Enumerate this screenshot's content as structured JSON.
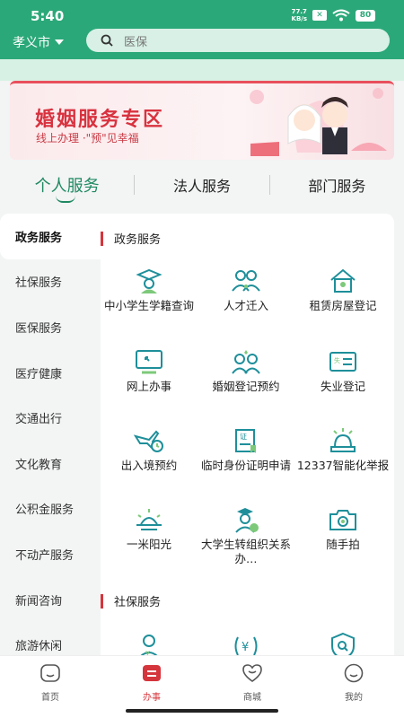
{
  "status": {
    "time": "5:40",
    "net_speed": "77.7",
    "net_unit": "KB/s",
    "battery": "80"
  },
  "header": {
    "city": "孝义市",
    "search_placeholder": "医保"
  },
  "banner": {
    "title": "婚姻服务专区",
    "subtitle": "线上办理 ·\"预\"见幸福"
  },
  "tabs": [
    {
      "label": "个人服务",
      "active": true
    },
    {
      "label": "法人服务",
      "active": false
    },
    {
      "label": "部门服务",
      "active": false
    }
  ],
  "sidebar": [
    {
      "label": "政务服务",
      "active": true
    },
    {
      "label": "社保服务"
    },
    {
      "label": "医保服务"
    },
    {
      "label": "医疗健康"
    },
    {
      "label": "交通出行"
    },
    {
      "label": "文化教育"
    },
    {
      "label": "公积金服务"
    },
    {
      "label": "不动产服务"
    },
    {
      "label": "新闻咨询"
    },
    {
      "label": "旅游休闲"
    }
  ],
  "sections": [
    {
      "title": "政务服务",
      "items": [
        {
          "label": "中小学生学籍查询",
          "icon": "student-cap-icon"
        },
        {
          "label": "人才迁入",
          "icon": "talent-icon"
        },
        {
          "label": "租赁房屋登记",
          "icon": "house-icon"
        },
        {
          "label": "网上办事",
          "icon": "monitor-icon"
        },
        {
          "label": "婚姻登记预约",
          "icon": "couple-icon"
        },
        {
          "label": "失业登记",
          "icon": "id-card-icon"
        },
        {
          "label": "出入境预约",
          "icon": "plane-clock-icon"
        },
        {
          "label": "临时身份证明申请",
          "icon": "certificate-icon"
        },
        {
          "label": "12337智能化举报",
          "icon": "alarm-bell-icon"
        },
        {
          "label": "一米阳光",
          "icon": "sun-icon"
        },
        {
          "label": "大学生转组织关系办…",
          "icon": "graduate-icon"
        },
        {
          "label": "随手拍",
          "icon": "camera-icon"
        }
      ]
    },
    {
      "title": "社保服务",
      "items": [
        {
          "label": "",
          "icon": "person-badge-icon"
        },
        {
          "label": "",
          "icon": "yuan-icon"
        },
        {
          "label": "",
          "icon": "shield-search-icon"
        }
      ]
    }
  ],
  "bottom_nav": [
    {
      "label": "首页",
      "icon": "home-icon"
    },
    {
      "label": "办事",
      "icon": "service-icon",
      "active": true
    },
    {
      "label": "商城",
      "icon": "mall-icon"
    },
    {
      "label": "我的",
      "icon": "profile-icon"
    }
  ],
  "colors": {
    "brand_green": "#2ba879",
    "accent_red": "#d5353c",
    "icon_teal": "#1e8f9a"
  }
}
